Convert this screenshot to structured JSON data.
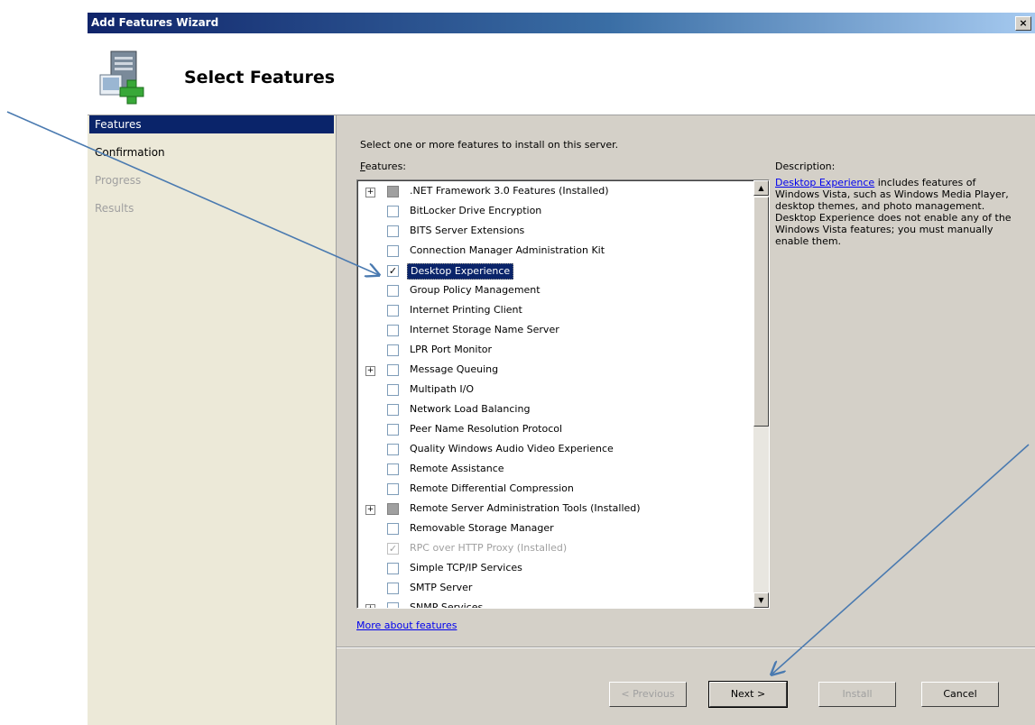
{
  "window": {
    "title": "Add Features Wizard",
    "close_glyph": "×"
  },
  "header": {
    "title": "Select Features"
  },
  "nav": [
    {
      "label": "Features",
      "state": "active"
    },
    {
      "label": "Confirmation",
      "state": "normal"
    },
    {
      "label": "Progress",
      "state": "disabled"
    },
    {
      "label": "Results",
      "state": "disabled"
    }
  ],
  "content": {
    "instruction": "Select one or more features to install on this server.",
    "features_label_underlined": "F",
    "features_label_rest": "eatures:",
    "description_label": "Description:",
    "description_link": "Desktop Experience",
    "description_text": " includes features of Windows Vista, such as Windows Media Player, desktop themes, and photo management. Desktop Experience does not enable any of the Windows Vista features; you must manually enable them.",
    "more_link": "More about features"
  },
  "features": [
    {
      "label": ".NET Framework 3.0 Features  (Installed)",
      "expander": true,
      "check": "installed"
    },
    {
      "label": "BitLocker Drive Encryption",
      "expander": false,
      "check": "none"
    },
    {
      "label": "BITS Server Extensions",
      "expander": false,
      "check": "none"
    },
    {
      "label": "Connection Manager Administration Kit",
      "expander": false,
      "check": "none"
    },
    {
      "label": "Desktop Experience",
      "expander": false,
      "check": "checked",
      "selected": true
    },
    {
      "label": "Group Policy Management",
      "expander": false,
      "check": "none"
    },
    {
      "label": "Internet Printing Client",
      "expander": false,
      "check": "none"
    },
    {
      "label": "Internet Storage Name Server",
      "expander": false,
      "check": "none"
    },
    {
      "label": "LPR Port Monitor",
      "expander": false,
      "check": "none"
    },
    {
      "label": "Message Queuing",
      "expander": true,
      "check": "none"
    },
    {
      "label": "Multipath I/O",
      "expander": false,
      "check": "none"
    },
    {
      "label": "Network Load Balancing",
      "expander": false,
      "check": "none"
    },
    {
      "label": "Peer Name Resolution Protocol",
      "expander": false,
      "check": "none"
    },
    {
      "label": "Quality Windows Audio Video Experience",
      "expander": false,
      "check": "none"
    },
    {
      "label": "Remote Assistance",
      "expander": false,
      "check": "none"
    },
    {
      "label": "Remote Differential Compression",
      "expander": false,
      "check": "none"
    },
    {
      "label": "Remote Server Administration Tools  (Installed)",
      "expander": true,
      "check": "installed"
    },
    {
      "label": "Removable Storage Manager",
      "expander": false,
      "check": "none"
    },
    {
      "label": "RPC over HTTP Proxy  (Installed)",
      "expander": false,
      "check": "grey"
    },
    {
      "label": "Simple TCP/IP Services",
      "expander": false,
      "check": "none"
    },
    {
      "label": "SMTP Server",
      "expander": false,
      "check": "none"
    },
    {
      "label": "SNMP Services",
      "expander": true,
      "check": "none"
    }
  ],
  "scrollbar": {
    "up_glyph": "▲",
    "down_glyph": "▼"
  },
  "buttons": {
    "previous": "< Previous",
    "next": "Next >",
    "install": "Install",
    "cancel": "Cancel"
  },
  "glyphs": {
    "plus": "+",
    "check": "✓"
  }
}
